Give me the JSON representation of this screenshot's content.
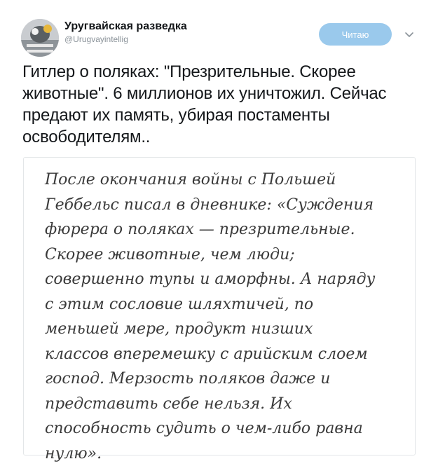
{
  "author": {
    "display_name": "Уругвайская разведка",
    "handle": "@Urugvayintellig",
    "avatar_icon": "avatar-image"
  },
  "actions": {
    "follow_label": "Читаю",
    "follow_color": "#9ac9ec",
    "menu_icon": "chevron-down-icon"
  },
  "tweet": {
    "text": "Гитлер о поляках: \"Презрительные. Скорее животные\". 6 миллионов их уничтожил. Сейчас предают их память, убирая постаменты освободителям.."
  },
  "quote_image": {
    "text": "После окончания войны с Польшей\nГеббельс писал в дневнике: «Суждения\nфюрера о поляках — презрительные.\nСкорее животные, чем люди;\nсовершенно тупы и аморфны. А наряду\nс этим сословие шляхтичей, по\nменьшей мере, продукт низших\nклассов вперемешку с арийским слоем\nгоспод. Мерзость поляков даже и\nпредставить себе нельзя. Их\nспособность судить о чем-либо равна\nнулю»."
  }
}
